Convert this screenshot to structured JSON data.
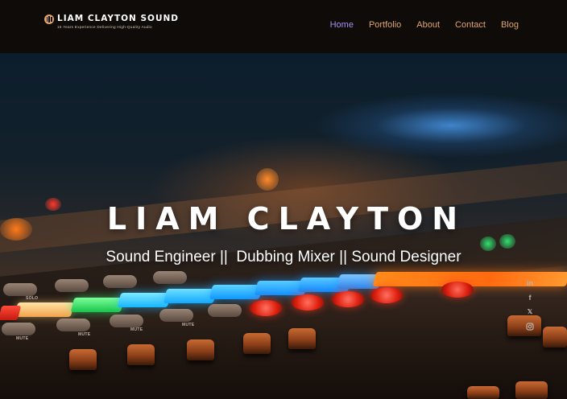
{
  "header": {
    "logo_name": "LIAM CLAYTON SOUND",
    "logo_tagline": "15 Years Experience Delivering High-Quality Audio"
  },
  "nav": {
    "items": [
      {
        "label": "Home",
        "active": true
      },
      {
        "label": "Portfolio"
      },
      {
        "label": "About"
      },
      {
        "label": "Contact"
      },
      {
        "label": "Blog"
      }
    ]
  },
  "hero": {
    "title": "LIAM CLAYTON",
    "subtitle": "Sound Engineer ||  Dubbing Mixer || Sound Designer",
    "console_labels": [
      "MUTE",
      "MUTE",
      "MUTE",
      "MUTE",
      "SOLO"
    ]
  },
  "social": {
    "icons": [
      "linkedin-icon",
      "facebook-icon",
      "twitter-icon",
      "instagram-icon"
    ],
    "linkedin_glyph": "in",
    "facebook_glyph": "f",
    "twitter_glyph": "𝕏"
  },
  "colors": {
    "accent": "#e0a56a",
    "nav_active": "#a88ef0",
    "header_bg": "#0e0b09"
  }
}
